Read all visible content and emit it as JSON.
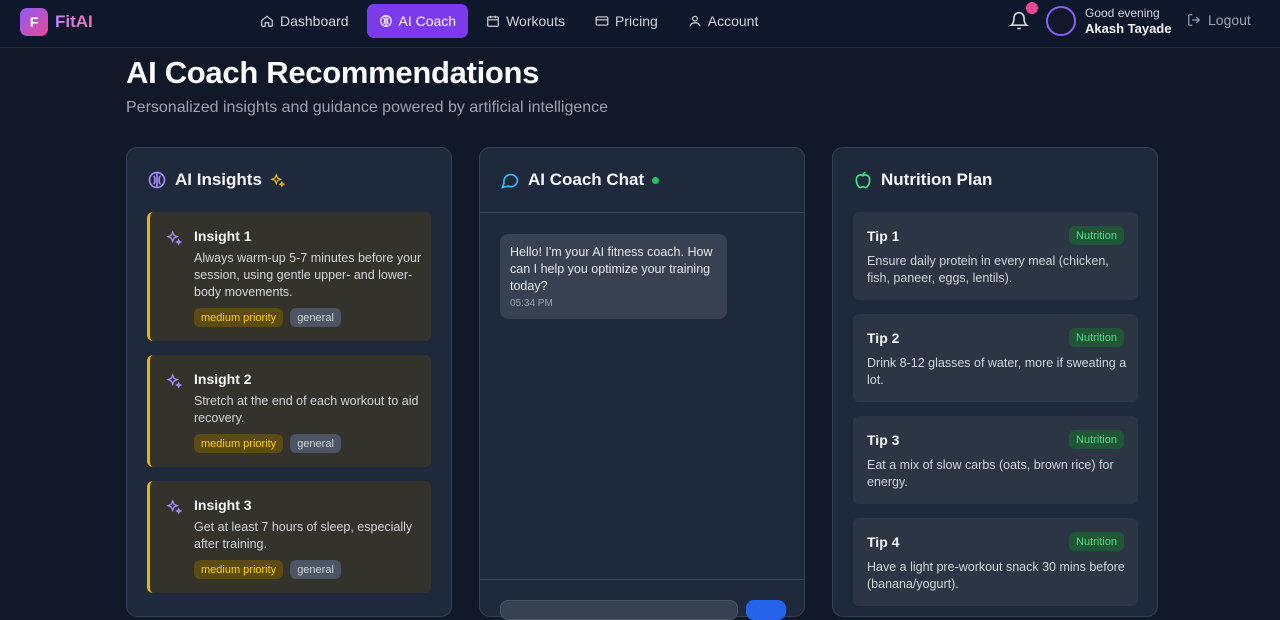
{
  "app": {
    "logo_letter": "F",
    "name": "FitAI"
  },
  "nav": {
    "items": [
      {
        "label": "Dashboard",
        "icon": "home-icon"
      },
      {
        "label": "AI Coach",
        "icon": "brain-icon",
        "active": true
      },
      {
        "label": "Workouts",
        "icon": "calendar-icon"
      },
      {
        "label": "Pricing",
        "icon": "credit-card-icon"
      },
      {
        "label": "Account",
        "icon": "user-icon"
      }
    ]
  },
  "user": {
    "greeting": "Good evening",
    "name": "Akash Tayade",
    "logout_label": "Logout"
  },
  "page": {
    "title": "AI Coach Recommendations",
    "subtitle": "Personalized insights and guidance powered by artificial intelligence"
  },
  "insights": {
    "title": "AI Insights",
    "items": [
      {
        "title": "Insight 1",
        "text": "Always warm-up 5-7 minutes before your session, using gentle upper- and lower-body movements.",
        "priority": "medium priority",
        "category": "general"
      },
      {
        "title": "Insight 2",
        "text": "Stretch at the end of each workout to aid recovery.",
        "priority": "medium priority",
        "category": "general"
      },
      {
        "title": "Insight 3",
        "text": "Get at least 7 hours of sleep, especially after training.",
        "priority": "medium priority",
        "category": "general"
      }
    ]
  },
  "chat": {
    "title": "AI Coach Chat",
    "messages": [
      {
        "text": "Hello! I'm your AI fitness coach. How can I help you optimize your training today?",
        "time": "05:34 PM"
      }
    ]
  },
  "nutrition": {
    "title": "Nutrition Plan",
    "tips": [
      {
        "title": "Tip 1",
        "badge": "Nutrition",
        "text": "Ensure daily protein in every meal (chicken, fish, paneer, eggs, lentils)."
      },
      {
        "title": "Tip 2",
        "badge": "Nutrition",
        "text": "Drink 8-12 glasses of water, more if sweating a lot."
      },
      {
        "title": "Tip 3",
        "badge": "Nutrition",
        "text": "Eat a mix of slow carbs (oats, brown rice) for energy."
      },
      {
        "title": "Tip 4",
        "badge": "Nutrition",
        "text": "Have a light pre-workout snack 30 mins before (banana/yogurt)."
      }
    ]
  },
  "colors": {
    "accent": "#7c3aed",
    "priority": "#eab308",
    "nutrition_badge": "#4ade80",
    "online": "#22c55e"
  }
}
